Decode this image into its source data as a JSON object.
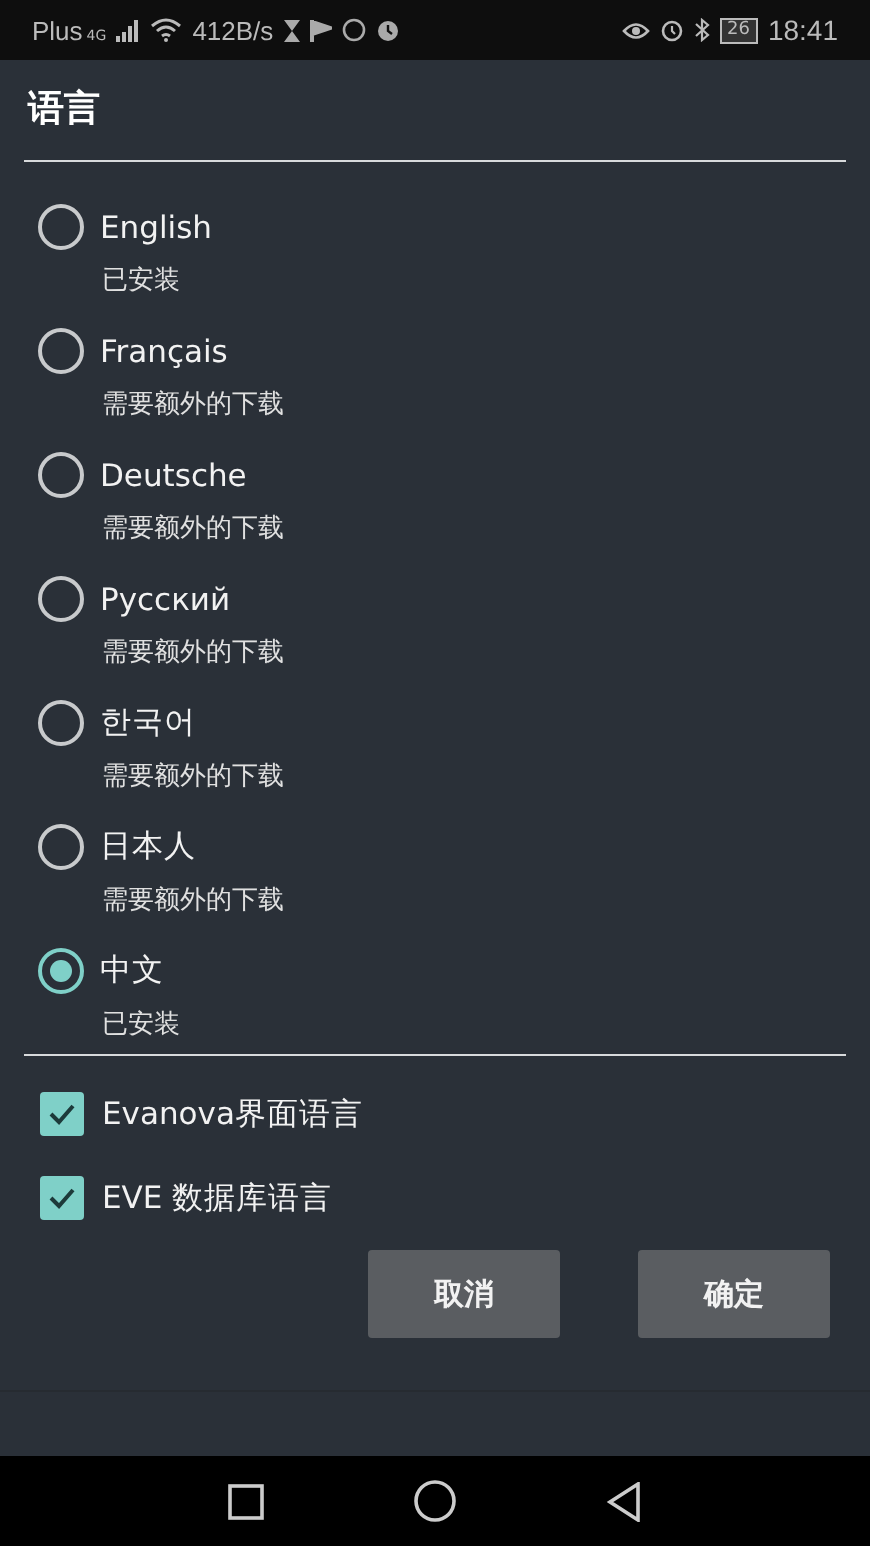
{
  "status_bar": {
    "carrier": "Plus",
    "network": "4G",
    "speed": "412B/s",
    "battery": "26",
    "time": "18:41"
  },
  "dialog": {
    "title": "语言",
    "languages": [
      {
        "label": "English",
        "note": "已安装",
        "selected": false
      },
      {
        "label": "Français",
        "note": "需要额外的下载",
        "selected": false
      },
      {
        "label": "Deutsche",
        "note": "需要额外的下载",
        "selected": false
      },
      {
        "label": "Русский",
        "note": "需要额外的下载",
        "selected": false
      },
      {
        "label": "한국어",
        "note": "需要额外的下载",
        "selected": false
      },
      {
        "label": "日本人",
        "note": "需要额外的下载",
        "selected": false
      },
      {
        "label": "中文",
        "note": "已安装",
        "selected": true
      }
    ],
    "options": [
      {
        "label": "Evanova界面语言",
        "checked": true
      },
      {
        "label": "EVE 数据库语言",
        "checked": true
      }
    ],
    "buttons": [
      "取消",
      "确定"
    ]
  }
}
